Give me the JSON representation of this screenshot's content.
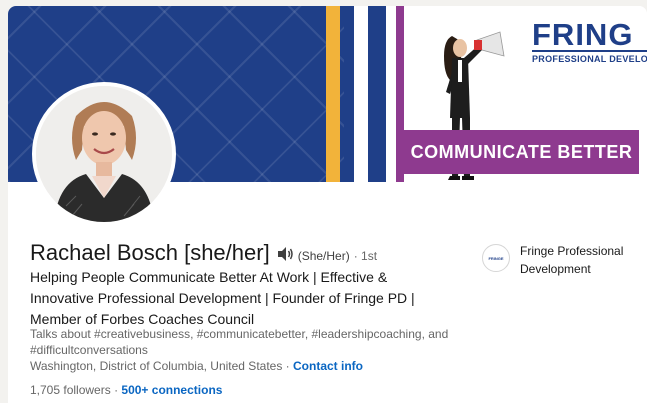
{
  "banner": {
    "brand_name": "FRING",
    "brand_sub": "PROFESSIONAL DEVELOP",
    "cta": "COMMUNICATE BETTER",
    "colors": {
      "navy": "#1f3f88",
      "gold": "#f2b33a",
      "purple": "#8e3a8f"
    }
  },
  "profile": {
    "name": "Rachael Bosch [she/her]",
    "pronunciation_icon": "speaker-icon",
    "pronouns": "(She/Her)",
    "degree": "· 1st",
    "headline": "Helping People Communicate Better At Work | Effective & Innovative Professional Development | Founder of Fringe PD | Member of Forbes Coaches Council",
    "topics": "Talks about #creativebusiness, #communicatebetter, #leadershipcoaching, and #difficultconversations",
    "location": "Washington, District of Columbia, United States",
    "contact_label": "Contact info",
    "followers": "1,705 followers",
    "connections": "500+ connections"
  },
  "company": {
    "name": "Fringe Professional Development",
    "logo_text": "FRINGE"
  }
}
